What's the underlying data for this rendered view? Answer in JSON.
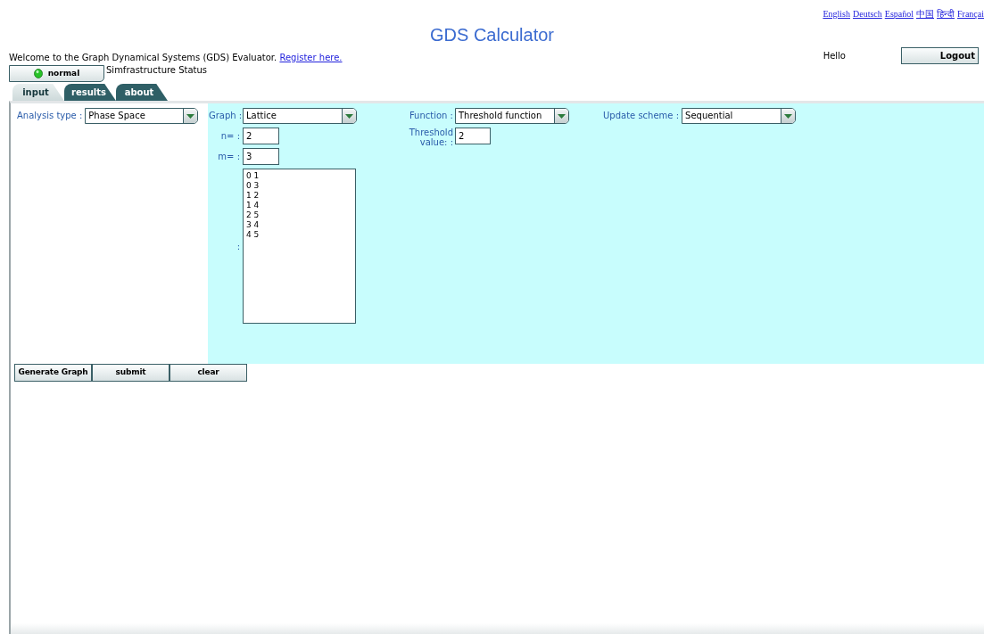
{
  "languages": [
    "English",
    "Deutsch",
    "Español",
    "中国",
    "हिन्दी",
    "Françai"
  ],
  "title": "GDS Calculator",
  "welcome": {
    "text": "Welcome to the Graph Dynamical Systems (GDS) Evaluator.",
    "link": "Register here."
  },
  "user": {
    "greeting": "Hello",
    "logout": "Logout"
  },
  "status": {
    "label": "normal",
    "caption": "Simfrastructure Status"
  },
  "tabs": [
    {
      "label": "input",
      "selected": true
    },
    {
      "label": "results",
      "selected": false
    },
    {
      "label": "about",
      "selected": false
    }
  ],
  "analysis": {
    "label": "Analysis type :",
    "value": "Phase Space"
  },
  "graph": {
    "label": "Graph :",
    "value": "Lattice",
    "n_label": "n= :",
    "n": "2",
    "m_label": "m= :",
    "m": "3",
    "edges_label": ":",
    "edges": [
      "0 1",
      "0 3",
      "1 2",
      "1 4",
      "2 5",
      "3 4",
      "4 5"
    ]
  },
  "function": {
    "label": "Function :",
    "value": "Threshold function",
    "threshold_label": "Threshold value: :",
    "threshold": "2"
  },
  "update": {
    "label": "Update scheme :",
    "value": "Sequential"
  },
  "buttons": [
    "Generate Graph",
    "submit",
    "clear"
  ]
}
